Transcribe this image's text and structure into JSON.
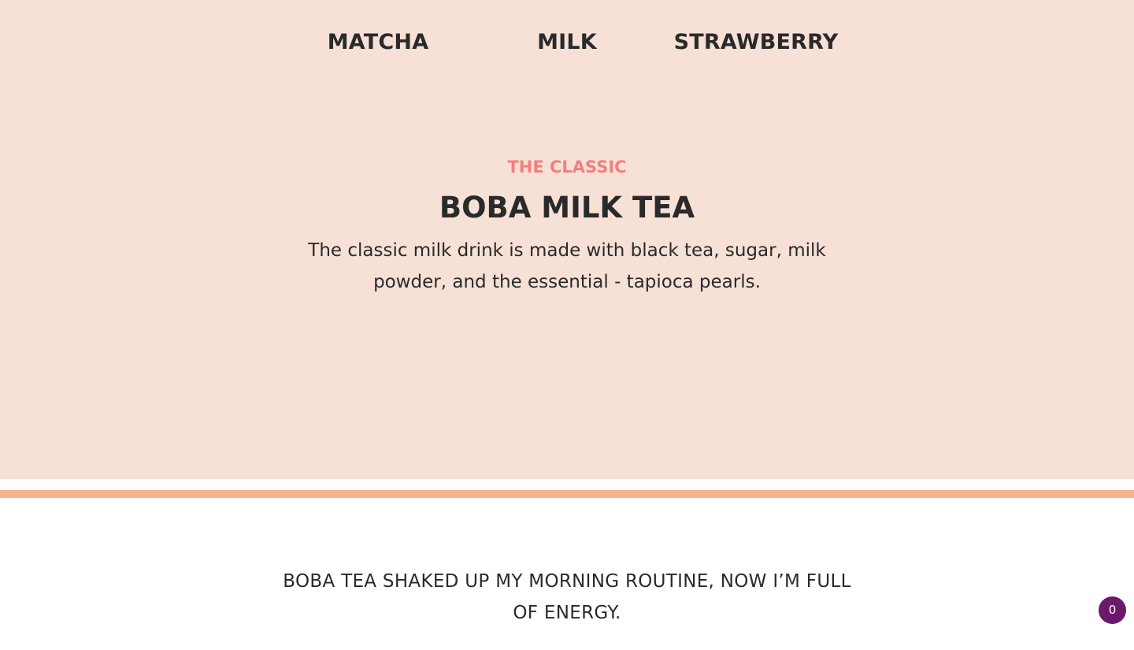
{
  "tabs": [
    {
      "label": "MATCHA"
    },
    {
      "label": "MILK"
    },
    {
      "label": "STRAWBERRY"
    }
  ],
  "product": {
    "eyebrow": "THE CLASSIC",
    "title": "BOBA MILK TEA",
    "description": "The classic milk drink is made with black tea, sugar, milk powder, and the essential - tapioca pearls."
  },
  "testimonial": {
    "quote": "BOBA TEA SHAKED UP MY MORNING ROUTINE, NOW I’M FULL OF ENERGY."
  },
  "cart": {
    "count": "0"
  },
  "colors": {
    "hero_background": "#f7e1d6",
    "accent_stripe": "#f9b08d",
    "eyebrow": "#f08080",
    "badge": "#6b1a6b"
  }
}
